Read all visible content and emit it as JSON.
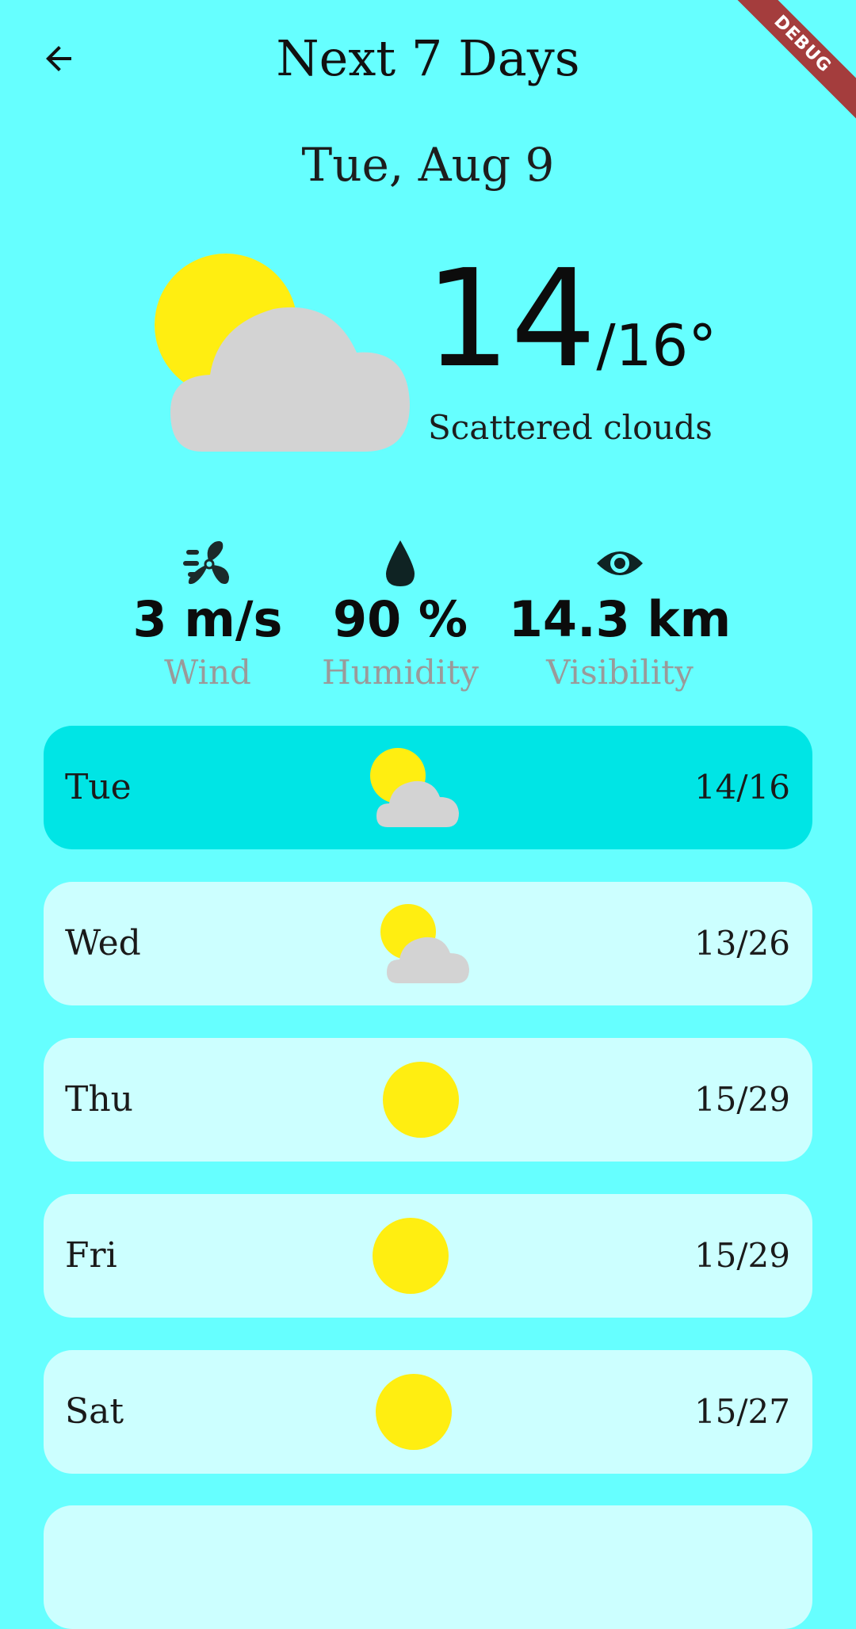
{
  "app_bar": {
    "title": "Next 7 Days",
    "back_icon": "arrow-back-icon",
    "debug_banner": "DEBUG"
  },
  "current": {
    "date": "Tue, Aug 9",
    "temp_low": "14",
    "temp_high": "/16°",
    "description": "Scattered clouds",
    "icon": "partly-cloudy-icon"
  },
  "stats": [
    {
      "icon": "fan-wind-icon",
      "value": "3 m/s",
      "label": "Wind"
    },
    {
      "icon": "water-drop-icon",
      "value": "90 %",
      "label": "Humidity"
    },
    {
      "icon": "eye-icon",
      "value": "14.3 km",
      "label": "Visibility"
    }
  ],
  "days": [
    {
      "day": "Tue",
      "temps": "14/16",
      "icon": "partly-cloudy-icon",
      "selected": true
    },
    {
      "day": "Wed",
      "temps": "13/26",
      "icon": "partly-cloudy-icon",
      "selected": false
    },
    {
      "day": "Thu",
      "temps": "15/29",
      "icon": "sun-icon",
      "selected": false
    },
    {
      "day": "Fri",
      "temps": "15/29",
      "icon": "sun-icon",
      "selected": false
    },
    {
      "day": "Sat",
      "temps": "15/27",
      "icon": "sun-icon",
      "selected": false
    }
  ],
  "colors": {
    "background": "#66FFFF",
    "row": "#CCFFFF",
    "row_selected": "#00E5E5",
    "sun": "#FFEE11",
    "cloud": "#D3D3D3",
    "muted_label": "#9A9A9A",
    "debug": "#A43D3D"
  }
}
